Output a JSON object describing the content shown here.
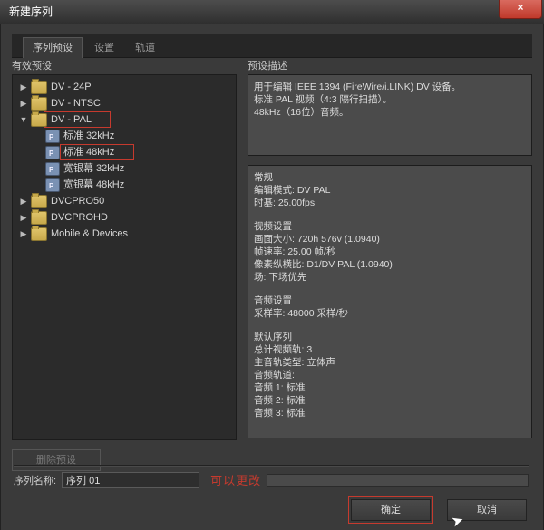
{
  "window": {
    "title": "新建序列"
  },
  "tabs": {
    "preset": "序列预设",
    "settings": "设置",
    "tracks": "轨道"
  },
  "left": {
    "header": "有效预设",
    "tree": [
      {
        "type": "folder",
        "depth": 0,
        "expanded": false,
        "label": "DV - 24P"
      },
      {
        "type": "folder",
        "depth": 0,
        "expanded": false,
        "label": "DV - NTSC"
      },
      {
        "type": "folder",
        "depth": 0,
        "expanded": true,
        "label": "DV - PAL",
        "mark": true
      },
      {
        "type": "preset",
        "depth": 1,
        "label": "标准 32kHz"
      },
      {
        "type": "preset",
        "depth": 1,
        "label": "标准 48kHz",
        "mark": true
      },
      {
        "type": "preset",
        "depth": 1,
        "label": "宽银幕 32kHz"
      },
      {
        "type": "preset",
        "depth": 1,
        "label": "宽银幕 48kHz"
      },
      {
        "type": "folder",
        "depth": 0,
        "expanded": false,
        "label": "DVCPRO50"
      },
      {
        "type": "folder",
        "depth": 0,
        "expanded": false,
        "label": "DVCPROHD"
      },
      {
        "type": "folder",
        "depth": 0,
        "expanded": false,
        "label": "Mobile & Devices"
      }
    ],
    "delete_label": "删除预设"
  },
  "right": {
    "header": "预设描述",
    "summary": [
      "用于编辑 IEEE 1394 (FireWire/i.LINK) DV 设备。",
      "标准 PAL 视频（4:3 隔行扫描）。",
      "48kHz（16位）音频。"
    ],
    "details": [
      "常规",
      "编辑模式: DV PAL",
      "时基: 25.00fps",
      "",
      "视频设置",
      "画面大小: 720h 576v (1.0940)",
      "帧速率: 25.00 帧/秒",
      "像素纵横比: D1/DV PAL (1.0940)",
      "场: 下场优先",
      "",
      "音频设置",
      "采样率: 48000 采样/秒",
      "",
      "默认序列",
      "总计视频轨: 3",
      "主音轨类型: 立体声",
      "音频轨道:",
      "音频 1: 标准",
      "音频 2: 标准",
      "音频 3: 标准"
    ]
  },
  "sequence": {
    "label": "序列名称:",
    "value": "序列 01",
    "note": "可以更改"
  },
  "buttons": {
    "ok": "确定",
    "cancel": "取消"
  }
}
